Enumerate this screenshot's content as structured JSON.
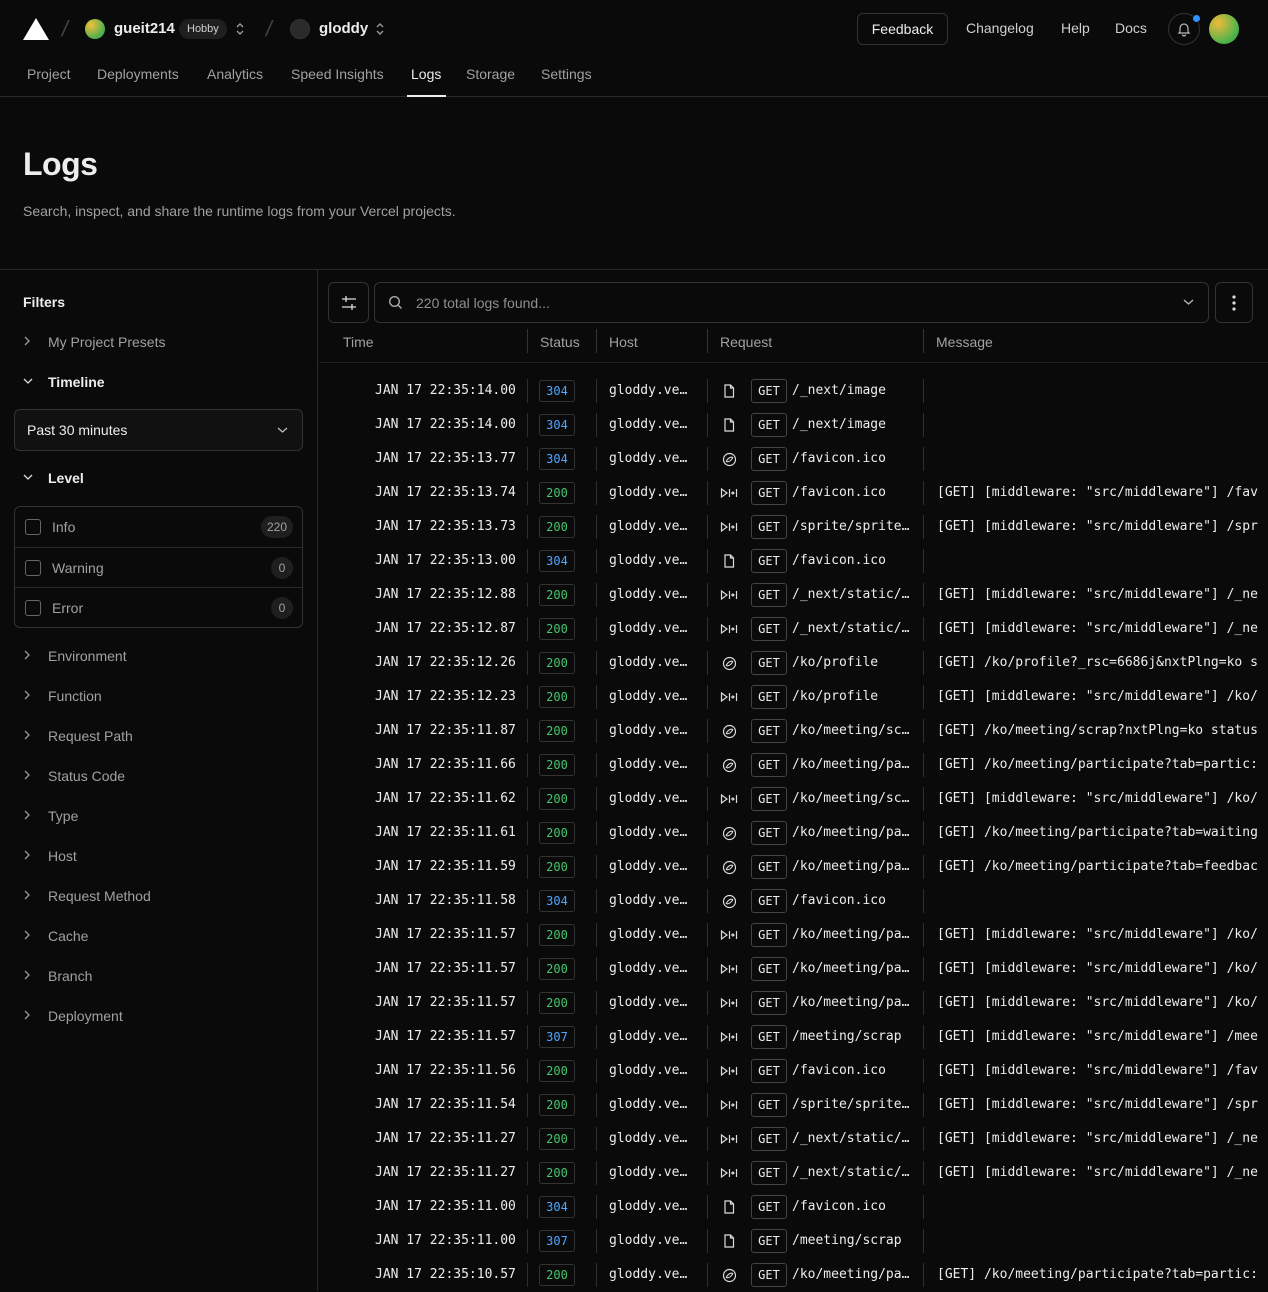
{
  "topbar": {
    "team_name": "gueit214",
    "team_badge": "Hobby",
    "project_name": "gloddy",
    "feedback_label": "Feedback",
    "links": [
      "Changelog",
      "Help",
      "Docs"
    ],
    "accent_color": "#3291ff"
  },
  "tabs": [
    "Project",
    "Deployments",
    "Analytics",
    "Speed Insights",
    "Logs",
    "Storage",
    "Settings"
  ],
  "active_tab": "Logs",
  "header": {
    "title": "Logs",
    "subtitle": "Search, inspect, and share the runtime logs from your Vercel projects."
  },
  "sidebar": {
    "title": "Filters",
    "presets": "My Project Presets",
    "timeline_label": "Timeline",
    "timeline_value": "Past 30 minutes",
    "level_label": "Level",
    "levels": [
      {
        "label": "Info",
        "count": "220"
      },
      {
        "label": "Warning",
        "count": "0"
      },
      {
        "label": "Error",
        "count": "0"
      }
    ],
    "filters": [
      "Environment",
      "Function",
      "Request Path",
      "Status Code",
      "Type",
      "Host",
      "Request Method",
      "Cache",
      "Branch",
      "Deployment"
    ]
  },
  "search": {
    "placeholder": "220 total logs found..."
  },
  "columns": [
    "Time",
    "Status",
    "Host",
    "Request",
    "Message"
  ],
  "status_colors": {
    "200": "#45c46d",
    "304": "#4ea6ff",
    "307": "#4ea6ff"
  },
  "rows": [
    {
      "time": "JAN 17 22:35:14.00",
      "status": "304",
      "host": "gloddy.ve…",
      "icon": "file-icon",
      "method": "GET",
      "path": "/_next/image",
      "message": ""
    },
    {
      "time": "JAN 17 22:35:14.00",
      "status": "304",
      "host": "gloddy.ve…",
      "icon": "file-icon",
      "method": "GET",
      "path": "/_next/image",
      "message": ""
    },
    {
      "time": "JAN 17 22:35:13.77",
      "status": "304",
      "host": "gloddy.ve…",
      "icon": "function-icon",
      "method": "GET",
      "path": "/favicon.ico",
      "message": ""
    },
    {
      "time": "JAN 17 22:35:13.74",
      "status": "200",
      "host": "gloddy.ve…",
      "icon": "middleware-icon",
      "method": "GET",
      "path": "/favicon.ico",
      "message": "[GET] [middleware: \"src/middleware\"] /fav"
    },
    {
      "time": "JAN 17 22:35:13.73",
      "status": "200",
      "host": "gloddy.ve…",
      "icon": "middleware-icon",
      "method": "GET",
      "path": "/sprite/sprite…",
      "message": "[GET] [middleware: \"src/middleware\"] /spr"
    },
    {
      "time": "JAN 17 22:35:13.00",
      "status": "304",
      "host": "gloddy.ve…",
      "icon": "file-icon",
      "method": "GET",
      "path": "/favicon.ico",
      "message": ""
    },
    {
      "time": "JAN 17 22:35:12.88",
      "status": "200",
      "host": "gloddy.ve…",
      "icon": "middleware-icon",
      "method": "GET",
      "path": "/_next/static/…",
      "message": "[GET] [middleware: \"src/middleware\"] /_ne"
    },
    {
      "time": "JAN 17 22:35:12.87",
      "status": "200",
      "host": "gloddy.ve…",
      "icon": "middleware-icon",
      "method": "GET",
      "path": "/_next/static/…",
      "message": "[GET] [middleware: \"src/middleware\"] /_ne"
    },
    {
      "time": "JAN 17 22:35:12.26",
      "status": "200",
      "host": "gloddy.ve…",
      "icon": "function-icon",
      "method": "GET",
      "path": "/ko/profile",
      "message": "[GET] /ko/profile?_rsc=6686j&nxtPlng=ko s"
    },
    {
      "time": "JAN 17 22:35:12.23",
      "status": "200",
      "host": "gloddy.ve…",
      "icon": "middleware-icon",
      "method": "GET",
      "path": "/ko/profile",
      "message": "[GET] [middleware: \"src/middleware\"] /ko/"
    },
    {
      "time": "JAN 17 22:35:11.87",
      "status": "200",
      "host": "gloddy.ve…",
      "icon": "function-icon",
      "method": "GET",
      "path": "/ko/meeting/sc…",
      "message": "[GET] /ko/meeting/scrap?nxtPlng=ko status"
    },
    {
      "time": "JAN 17 22:35:11.66",
      "status": "200",
      "host": "gloddy.ve…",
      "icon": "function-icon",
      "method": "GET",
      "path": "/ko/meeting/pa…",
      "message": "[GET] /ko/meeting/participate?tab=partic:"
    },
    {
      "time": "JAN 17 22:35:11.62",
      "status": "200",
      "host": "gloddy.ve…",
      "icon": "middleware-icon",
      "method": "GET",
      "path": "/ko/meeting/sc…",
      "message": "[GET] [middleware: \"src/middleware\"] /ko/"
    },
    {
      "time": "JAN 17 22:35:11.61",
      "status": "200",
      "host": "gloddy.ve…",
      "icon": "function-icon",
      "method": "GET",
      "path": "/ko/meeting/pa…",
      "message": "[GET] /ko/meeting/participate?tab=waiting"
    },
    {
      "time": "JAN 17 22:35:11.59",
      "status": "200",
      "host": "gloddy.ve…",
      "icon": "function-icon",
      "method": "GET",
      "path": "/ko/meeting/pa…",
      "message": "[GET] /ko/meeting/participate?tab=feedbac"
    },
    {
      "time": "JAN 17 22:35:11.58",
      "status": "304",
      "host": "gloddy.ve…",
      "icon": "function-icon",
      "method": "GET",
      "path": "/favicon.ico",
      "message": ""
    },
    {
      "time": "JAN 17 22:35:11.57",
      "status": "200",
      "host": "gloddy.ve…",
      "icon": "middleware-icon",
      "method": "GET",
      "path": "/ko/meeting/pa…",
      "message": "[GET] [middleware: \"src/middleware\"] /ko/"
    },
    {
      "time": "JAN 17 22:35:11.57",
      "status": "200",
      "host": "gloddy.ve…",
      "icon": "middleware-icon",
      "method": "GET",
      "path": "/ko/meeting/pa…",
      "message": "[GET] [middleware: \"src/middleware\"] /ko/"
    },
    {
      "time": "JAN 17 22:35:11.57",
      "status": "200",
      "host": "gloddy.ve…",
      "icon": "middleware-icon",
      "method": "GET",
      "path": "/ko/meeting/pa…",
      "message": "[GET] [middleware: \"src/middleware\"] /ko/"
    },
    {
      "time": "JAN 17 22:35:11.57",
      "status": "307",
      "host": "gloddy.ve…",
      "icon": "middleware-icon",
      "method": "GET",
      "path": "/meeting/scrap",
      "message": "[GET] [middleware: \"src/middleware\"] /mee"
    },
    {
      "time": "JAN 17 22:35:11.56",
      "status": "200",
      "host": "gloddy.ve…",
      "icon": "middleware-icon",
      "method": "GET",
      "path": "/favicon.ico",
      "message": "[GET] [middleware: \"src/middleware\"] /fav"
    },
    {
      "time": "JAN 17 22:35:11.54",
      "status": "200",
      "host": "gloddy.ve…",
      "icon": "middleware-icon",
      "method": "GET",
      "path": "/sprite/sprite…",
      "message": "[GET] [middleware: \"src/middleware\"] /spr"
    },
    {
      "time": "JAN 17 22:35:11.27",
      "status": "200",
      "host": "gloddy.ve…",
      "icon": "middleware-icon",
      "method": "GET",
      "path": "/_next/static/…",
      "message": "[GET] [middleware: \"src/middleware\"] /_ne"
    },
    {
      "time": "JAN 17 22:35:11.27",
      "status": "200",
      "host": "gloddy.ve…",
      "icon": "middleware-icon",
      "method": "GET",
      "path": "/_next/static/…",
      "message": "[GET] [middleware: \"src/middleware\"] /_ne"
    },
    {
      "time": "JAN 17 22:35:11.00",
      "status": "304",
      "host": "gloddy.ve…",
      "icon": "file-icon",
      "method": "GET",
      "path": "/favicon.ico",
      "message": ""
    },
    {
      "time": "JAN 17 22:35:11.00",
      "status": "307",
      "host": "gloddy.ve…",
      "icon": "file-icon",
      "method": "GET",
      "path": "/meeting/scrap",
      "message": ""
    },
    {
      "time": "JAN 17 22:35:10.57",
      "status": "200",
      "host": "gloddy.ve…",
      "icon": "function-icon",
      "method": "GET",
      "path": "/ko/meeting/pa…",
      "message": "[GET] /ko/meeting/participate?tab=partic:"
    }
  ]
}
